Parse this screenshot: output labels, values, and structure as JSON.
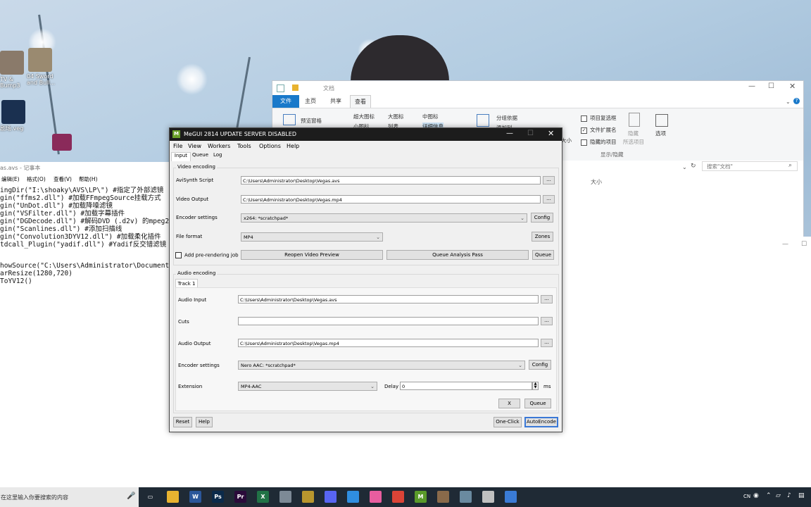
{
  "desktop": {
    "icons": [
      {
        "label_lines": [
          "TV &",
          "Bump3"
        ],
        "name": "desktop-icon-tv-bump"
      },
      {
        "label_lines": [
          "04 Sword",
          "and Bull..."
        ],
        "name": "desktop-icon-sword"
      },
      {
        "label_lines": [
          "剧场.veg"
        ],
        "name": "desktop-icon-veg"
      }
    ]
  },
  "explorer": {
    "title": "文档",
    "tabs": [
      "文件",
      "主页",
      "共享",
      "查看"
    ],
    "ribbon": {
      "preview_pane": "预览窗格",
      "extra_large_icons": "超大图标",
      "large_icons": "大图标",
      "medium_icons": "中图标",
      "small_icons": "小图标",
      "list": "列表",
      "details": "详细信息",
      "group_by": "分组依据",
      "add_column": "添加列",
      "size": "大小",
      "item_checkboxes": "项目复选框",
      "file_extensions": "文件扩展名",
      "hidden_items": "隐藏的项目",
      "hide": "隐藏",
      "selected_items": "所选项目",
      "options": "选项",
      "group_show_hide": "显示/隐藏"
    },
    "checkboxes": {
      "item_checkboxes": false,
      "file_extensions": true,
      "hidden_items": false
    },
    "search_placeholder": "搜索\"文档\"",
    "column_size": "大小"
  },
  "notepad": {
    "title": "as.avs - 记事本",
    "menu": [
      "编辑(E)",
      "格式(O)",
      "查看(V)",
      "帮助(H)"
    ],
    "lines": [
      "ingDir(\"I:\\shoaky\\AVS\\LP\\\")   #指定了外部滤镜",
      "gin(\"ffms2.dll\")   #加载FFmpegSource挂载方式",
      "gin(\"UnDot.dll\")   #加载降噪滤镜",
      "gin(\"VSFilter.dll\")   #加载字幕插件",
      "gin(\"DGDecode.dll\")   #解码DVD (.d2v) 的mpeg2",
      "gin(\"Scanlines.dll\")   #添加扫描线",
      "gin(\"Convolution3DYV12.dll\")   #加载柔化插件",
      "tdcall_Plugin(\"yadif.dll\")   #Yadif反交错滤镜",
      "",
      "howSource(\"C:\\Users\\Administrator\\Documents\\",
      "arResize(1280,720)",
      "ToYV12()"
    ]
  },
  "megui": {
    "title": "MeGUI 2814 UPDATE SERVER DISABLED",
    "menu": [
      "File",
      "View",
      "Workers",
      "Tools",
      "Options",
      "Help"
    ],
    "tabs": [
      "Input",
      "Queue",
      "Log"
    ],
    "video": {
      "group": "Video encoding",
      "avisynth_label": "AviSynth Script",
      "avisynth_value": "C:\\Users\\Administrator\\Desktop\\Vegas.avs",
      "output_label": "Video Output",
      "output_value": "C:\\Users\\Administrator\\Desktop\\Vegas.mp4",
      "encoder_label": "Encoder settings",
      "encoder_value": "x264: *scratchpad*",
      "config": "Config",
      "format_label": "File format",
      "format_value": "MP4",
      "zones": "Zones",
      "prerender_label": "Add pre-rendering job",
      "prerender_checked": false,
      "reopen": "Reopen Video Preview",
      "analysis": "Queue Analysis Pass",
      "queue": "Queue"
    },
    "audio": {
      "group": "Audio encoding",
      "track_tab": "Track 1",
      "input_label": "Audio Input",
      "input_value": "C:\\Users\\Administrator\\Desktop\\Vegas.avs",
      "cuts_label": "Cuts",
      "cuts_value": "",
      "output_label": "Audio Output",
      "output_value": "C:\\Users\\Administrator\\Desktop\\Vegas.mp4",
      "encoder_label": "Encoder settings",
      "encoder_value": "Nero AAC: *scratchpad*",
      "config": "Config",
      "extension_label": "Extension",
      "extension_value": "MP4-AAC",
      "delay_label": "Delay",
      "delay_value": "0",
      "ms": "ms",
      "x": "X",
      "queue": "Queue"
    },
    "footer": {
      "reset": "Reset",
      "help": "Help",
      "oneclick": "One-Click",
      "autoencode": "AutoEncode"
    },
    "browse": "..."
  },
  "taskbar": {
    "search_placeholder": "在这里输入你要搜索的内容",
    "lang": "CN",
    "apps": [
      {
        "name": "task-view-icon",
        "glyph": "▭",
        "color": "#1f2a35"
      },
      {
        "name": "file-explorer-icon",
        "glyph": "",
        "color": "#e8b330"
      },
      {
        "name": "word-icon",
        "glyph": "W",
        "color": "#2b579a"
      },
      {
        "name": "photoshop-icon",
        "glyph": "Ps",
        "color": "#0b2a4a"
      },
      {
        "name": "premiere-icon",
        "glyph": "Pr",
        "color": "#2a0b3a"
      },
      {
        "name": "excel-icon",
        "glyph": "X",
        "color": "#217346"
      },
      {
        "name": "app-icon-1",
        "glyph": "",
        "color": "#7d8a96"
      },
      {
        "name": "app-icon-2",
        "glyph": "",
        "color": "#b8962e"
      },
      {
        "name": "discord-icon",
        "glyph": "",
        "color": "#5865f2"
      },
      {
        "name": "app-icon-3",
        "glyph": "",
        "color": "#2f8ee0"
      },
      {
        "name": "itunes-icon",
        "glyph": "",
        "color": "#e85d9f"
      },
      {
        "name": "chrome-icon",
        "glyph": "",
        "color": "#db4437"
      },
      {
        "name": "megui-icon",
        "glyph": "M",
        "color": "#5a9a2a"
      },
      {
        "name": "avatar-app-icon",
        "glyph": "",
        "color": "#8a6a4a"
      },
      {
        "name": "app-icon-4",
        "glyph": "",
        "color": "#6a8aa0"
      },
      {
        "name": "app-icon-5",
        "glyph": "",
        "color": "#c0c0c0"
      },
      {
        "name": "app-icon-6",
        "glyph": "",
        "color": "#3a7bd5"
      }
    ]
  }
}
